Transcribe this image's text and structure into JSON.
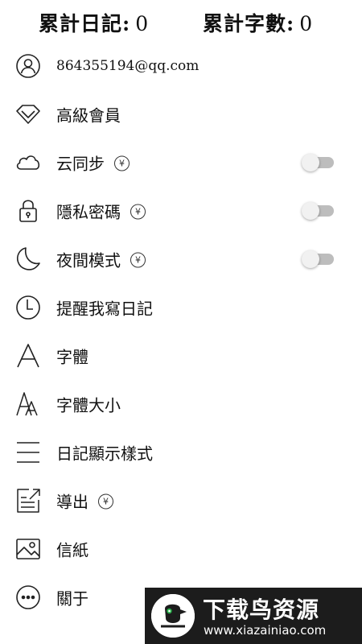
{
  "header": {
    "total_diaries_label": "累計日記:",
    "total_diaries_value": "0",
    "total_words_label": "累計字數:",
    "total_words_value": "0"
  },
  "menu": {
    "account": {
      "label": "864355194@qq.com",
      "icon": "user-icon"
    },
    "vip": {
      "label": "高級會員",
      "icon": "diamond-icon"
    },
    "cloud_sync": {
      "label": "云同步",
      "icon": "cloud-icon",
      "badge": "¥",
      "toggle_on": false
    },
    "privacy_lock": {
      "label": "隱私密碼",
      "icon": "lock-icon",
      "badge": "¥",
      "toggle_on": false
    },
    "night_mode": {
      "label": "夜間模式",
      "icon": "moon-icon",
      "badge": "¥",
      "toggle_on": false
    },
    "reminder": {
      "label": "提醒我寫日記",
      "icon": "clock-icon"
    },
    "font": {
      "label": "字體",
      "icon": "font-icon"
    },
    "font_size": {
      "label": "字體大小",
      "icon": "font-size-icon"
    },
    "display_style": {
      "label": "日記顯示樣式",
      "icon": "list-icon"
    },
    "export": {
      "label": "導出",
      "icon": "export-icon",
      "badge": "¥"
    },
    "letter_paper": {
      "label": "信紙",
      "icon": "image-icon"
    },
    "about": {
      "label": "關于",
      "icon": "more-icon"
    }
  },
  "watermark": {
    "title": "下载鸟资源",
    "url": "www.xiazainiao.com"
  },
  "colors": {
    "text": "#111111",
    "toggle_track": "#bdbdbd",
    "toggle_knob": "#f1f1f1",
    "watermark_bg": "#1c1c1c",
    "watermark_accent": "#2bb24c"
  }
}
